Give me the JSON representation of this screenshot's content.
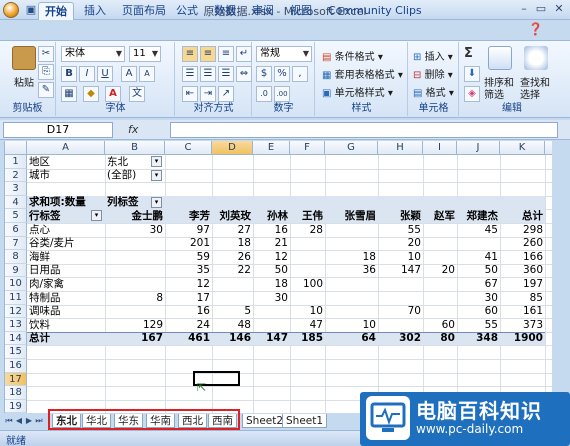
{
  "window": {
    "title": "原始数据.xlsx - Microsoft Excel",
    "minimize": "–",
    "restore": "▭",
    "close": "✕"
  },
  "tabs": [
    "开始",
    "插入",
    "页面布局",
    "公式",
    "数据",
    "审阅",
    "视图",
    "Community Clips"
  ],
  "ribbon": {
    "clipboard": {
      "label": "剪贴板",
      "paste": "粘贴"
    },
    "font": {
      "label": "字体",
      "name": "宋体",
      "size": "11",
      "bold": "B",
      "italic": "I",
      "underline": "U",
      "grow": "A",
      "shrink": "A",
      "color_a": "A",
      "wen": "文"
    },
    "align": {
      "label": "对齐方式"
    },
    "number": {
      "label": "数字",
      "format": "常规",
      "pct": "%",
      "comma": ",",
      "inc": ".0",
      "dec": ".00",
      "cur": "$"
    },
    "styles": {
      "label": "样式",
      "cond": "条件格式",
      "table": "套用表格格式",
      "cell": "单元格样式"
    },
    "cells": {
      "label": "单元格",
      "insert": "插入",
      "delete": "删除",
      "format": "格式"
    },
    "editing": {
      "label": "编辑",
      "sum": "Σ",
      "sort": "排序和",
      "sort2": "筛选",
      "find": "查找和",
      "find2": "选择"
    }
  },
  "formula": {
    "name_box": "D17",
    "fx": "fx",
    "value": ""
  },
  "columns": [
    "A",
    "B",
    "C",
    "D",
    "E",
    "F",
    "G",
    "H",
    "I",
    "J",
    "K",
    "L"
  ],
  "rows": [
    "1",
    "2",
    "3",
    "4",
    "5",
    "6",
    "7",
    "8",
    "9",
    "10",
    "11",
    "12",
    "13",
    "14",
    "15",
    "16",
    "17",
    "18",
    "19"
  ],
  "pivot": {
    "filters": [
      {
        "label": "地区",
        "value": "东北"
      },
      {
        "label": "城市",
        "value": "(全部)"
      }
    ],
    "values_label": "求和项:数量",
    "col_label": "列标签",
    "row_label": "行标签",
    "people": [
      "金士鹏",
      "李芳",
      "刘英玫",
      "孙林",
      "王伟",
      "张雪眉",
      "张颖",
      "赵军",
      "郑建杰",
      "总计"
    ],
    "rows": [
      {
        "name": "点心",
        "vals": [
          "30",
          "97",
          "27",
          "16",
          "28",
          "",
          "55",
          "",
          "45",
          "298"
        ]
      },
      {
        "name": "谷类/麦片",
        "vals": [
          "",
          "201",
          "18",
          "21",
          "",
          "",
          "20",
          "",
          "",
          "260"
        ]
      },
      {
        "name": "海鲜",
        "vals": [
          "",
          "59",
          "26",
          "12",
          "",
          "18",
          "10",
          "",
          "41",
          "166"
        ]
      },
      {
        "name": "日用品",
        "vals": [
          "",
          "35",
          "22",
          "50",
          "",
          "36",
          "147",
          "20",
          "50",
          "360"
        ]
      },
      {
        "name": "肉/家禽",
        "vals": [
          "",
          "12",
          "",
          "18",
          "100",
          "",
          "",
          "",
          "67",
          "197"
        ]
      },
      {
        "name": "特制品",
        "vals": [
          "8",
          "17",
          "",
          "30",
          "",
          "",
          "",
          "",
          "30",
          "85"
        ]
      },
      {
        "name": "调味品",
        "vals": [
          "",
          "16",
          "5",
          "",
          "10",
          "",
          "70",
          "",
          "60",
          "161"
        ]
      },
      {
        "name": "饮料",
        "vals": [
          "129",
          "24",
          "48",
          "",
          "47",
          "10",
          "",
          "60",
          "55",
          "373"
        ]
      }
    ],
    "total": {
      "name": "总计",
      "vals": [
        "167",
        "461",
        "146",
        "147",
        "185",
        "64",
        "302",
        "80",
        "348",
        "1900"
      ]
    }
  },
  "sheet_tabs": [
    "东北",
    "华北",
    "华东",
    "华南",
    "西北",
    "西南",
    "Sheet2",
    "Sheet1"
  ],
  "status": "就绪",
  "watermark": {
    "title": "电脑百科知识",
    "url": "www.pc-daily.com"
  },
  "colors": {
    "accent": "#15428b",
    "ribbon": "#d5e4f5",
    "highlight": "#e02020"
  }
}
